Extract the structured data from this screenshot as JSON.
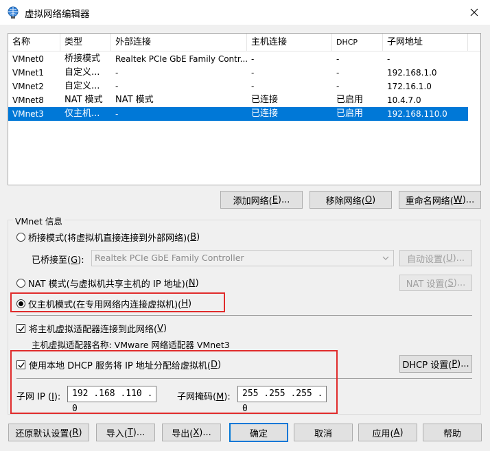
{
  "window": {
    "title": "虚拟网络编辑器",
    "icon": "network-globe-icon",
    "close_icon": "close-icon"
  },
  "network_list": {
    "columns": [
      "名称",
      "类型",
      "外部连接",
      "主机连接",
      "DHCP",
      "子网地址"
    ],
    "rows": [
      {
        "name": "VMnet0",
        "type": "桥接模式",
        "external": "Realtek PCIe GbE Family Contr...",
        "host": "-",
        "dhcp": "-",
        "subnet": "-",
        "selected": false
      },
      {
        "name": "VMnet1",
        "type": "自定义...",
        "external": "-",
        "host": "-",
        "dhcp": "-",
        "subnet": "192.168.1.0",
        "selected": false
      },
      {
        "name": "VMnet2",
        "type": "自定义...",
        "external": "-",
        "host": "-",
        "dhcp": "-",
        "subnet": "172.16.1.0",
        "selected": false
      },
      {
        "name": "VMnet8",
        "type": "NAT 模式",
        "external": "NAT 模式",
        "host": "已连接",
        "dhcp": "已启用",
        "subnet": "10.4.7.0",
        "selected": false
      },
      {
        "name": "VMnet3",
        "type": "仅主机...",
        "external": "-",
        "host": "已连接",
        "dhcp": "已启用",
        "subnet": "192.168.110.0",
        "selected": true
      }
    ]
  },
  "list_buttons": {
    "add": {
      "text": "添加网络(",
      "key": "E",
      "suffix": ")..."
    },
    "remove": {
      "text": "移除网络(",
      "key": "O",
      "suffix": ")"
    },
    "rename": {
      "text": "重命名网络(",
      "key": "W",
      "suffix": ")..."
    }
  },
  "vmnet_info": {
    "group_label": "VMnet 信息",
    "bridged": {
      "text": "桥接模式(将虚拟机直接连接到外部网络)(",
      "key": "B",
      "suffix": ")",
      "checked": false
    },
    "bridged_to": {
      "text": "已桥接至(",
      "key": "G",
      "suffix": "):"
    },
    "bridged_adapter": "Realtek PCIe GbE Family Controller",
    "auto_settings": {
      "text": "自动设置(",
      "key": "U",
      "suffix": ")..."
    },
    "nat": {
      "text": "NAT 模式(与虚拟机共享主机的 IP 地址)(",
      "key": "N",
      "suffix": ")",
      "checked": false
    },
    "nat_settings": {
      "text": "NAT 设置(",
      "key": "S",
      "suffix": ")..."
    },
    "host_only": {
      "text": "仅主机模式(在专用网络内连接虚拟机)(",
      "key": "H",
      "suffix": ")",
      "checked": true
    },
    "connect_adapter": {
      "text": "将主机虚拟适配器连接到此网络(",
      "key": "V",
      "suffix": ")",
      "checked": true
    },
    "adapter_name": "主机虚拟适配器名称: VMware 网络适配器 VMnet3",
    "use_dhcp": {
      "text": "使用本地 DHCP 服务将 IP 地址分配给虚拟机(",
      "key": "D",
      "suffix": ")",
      "checked": true
    },
    "dhcp_settings": {
      "text": "DHCP 设置(",
      "key": "P",
      "suffix": ")..."
    },
    "subnet_ip_label": {
      "text": "子网 IP (",
      "key": "I",
      "suffix": "):"
    },
    "subnet_ip_value": "192 .168 .110 . 0",
    "subnet_mask_label": {
      "text": "子网掩码(",
      "key": "M",
      "suffix": "):"
    },
    "subnet_mask_value": "255 .255 .255 . 0"
  },
  "footer_buttons": {
    "restore": {
      "text": "还原默认设置(",
      "key": "R",
      "suffix": ")"
    },
    "import": {
      "text": "导入(",
      "key": "T",
      "suffix": ")..."
    },
    "export": {
      "text": "导出(",
      "key": "X",
      "suffix": ")..."
    },
    "ok": {
      "text": "确定"
    },
    "cancel": {
      "text": "取消"
    },
    "apply": {
      "text": "应用(",
      "key": "A",
      "suffix": ")"
    },
    "help": {
      "text": "帮助"
    }
  },
  "colors": {
    "selection": "#0078d7",
    "annotation": "#e02b2b"
  }
}
